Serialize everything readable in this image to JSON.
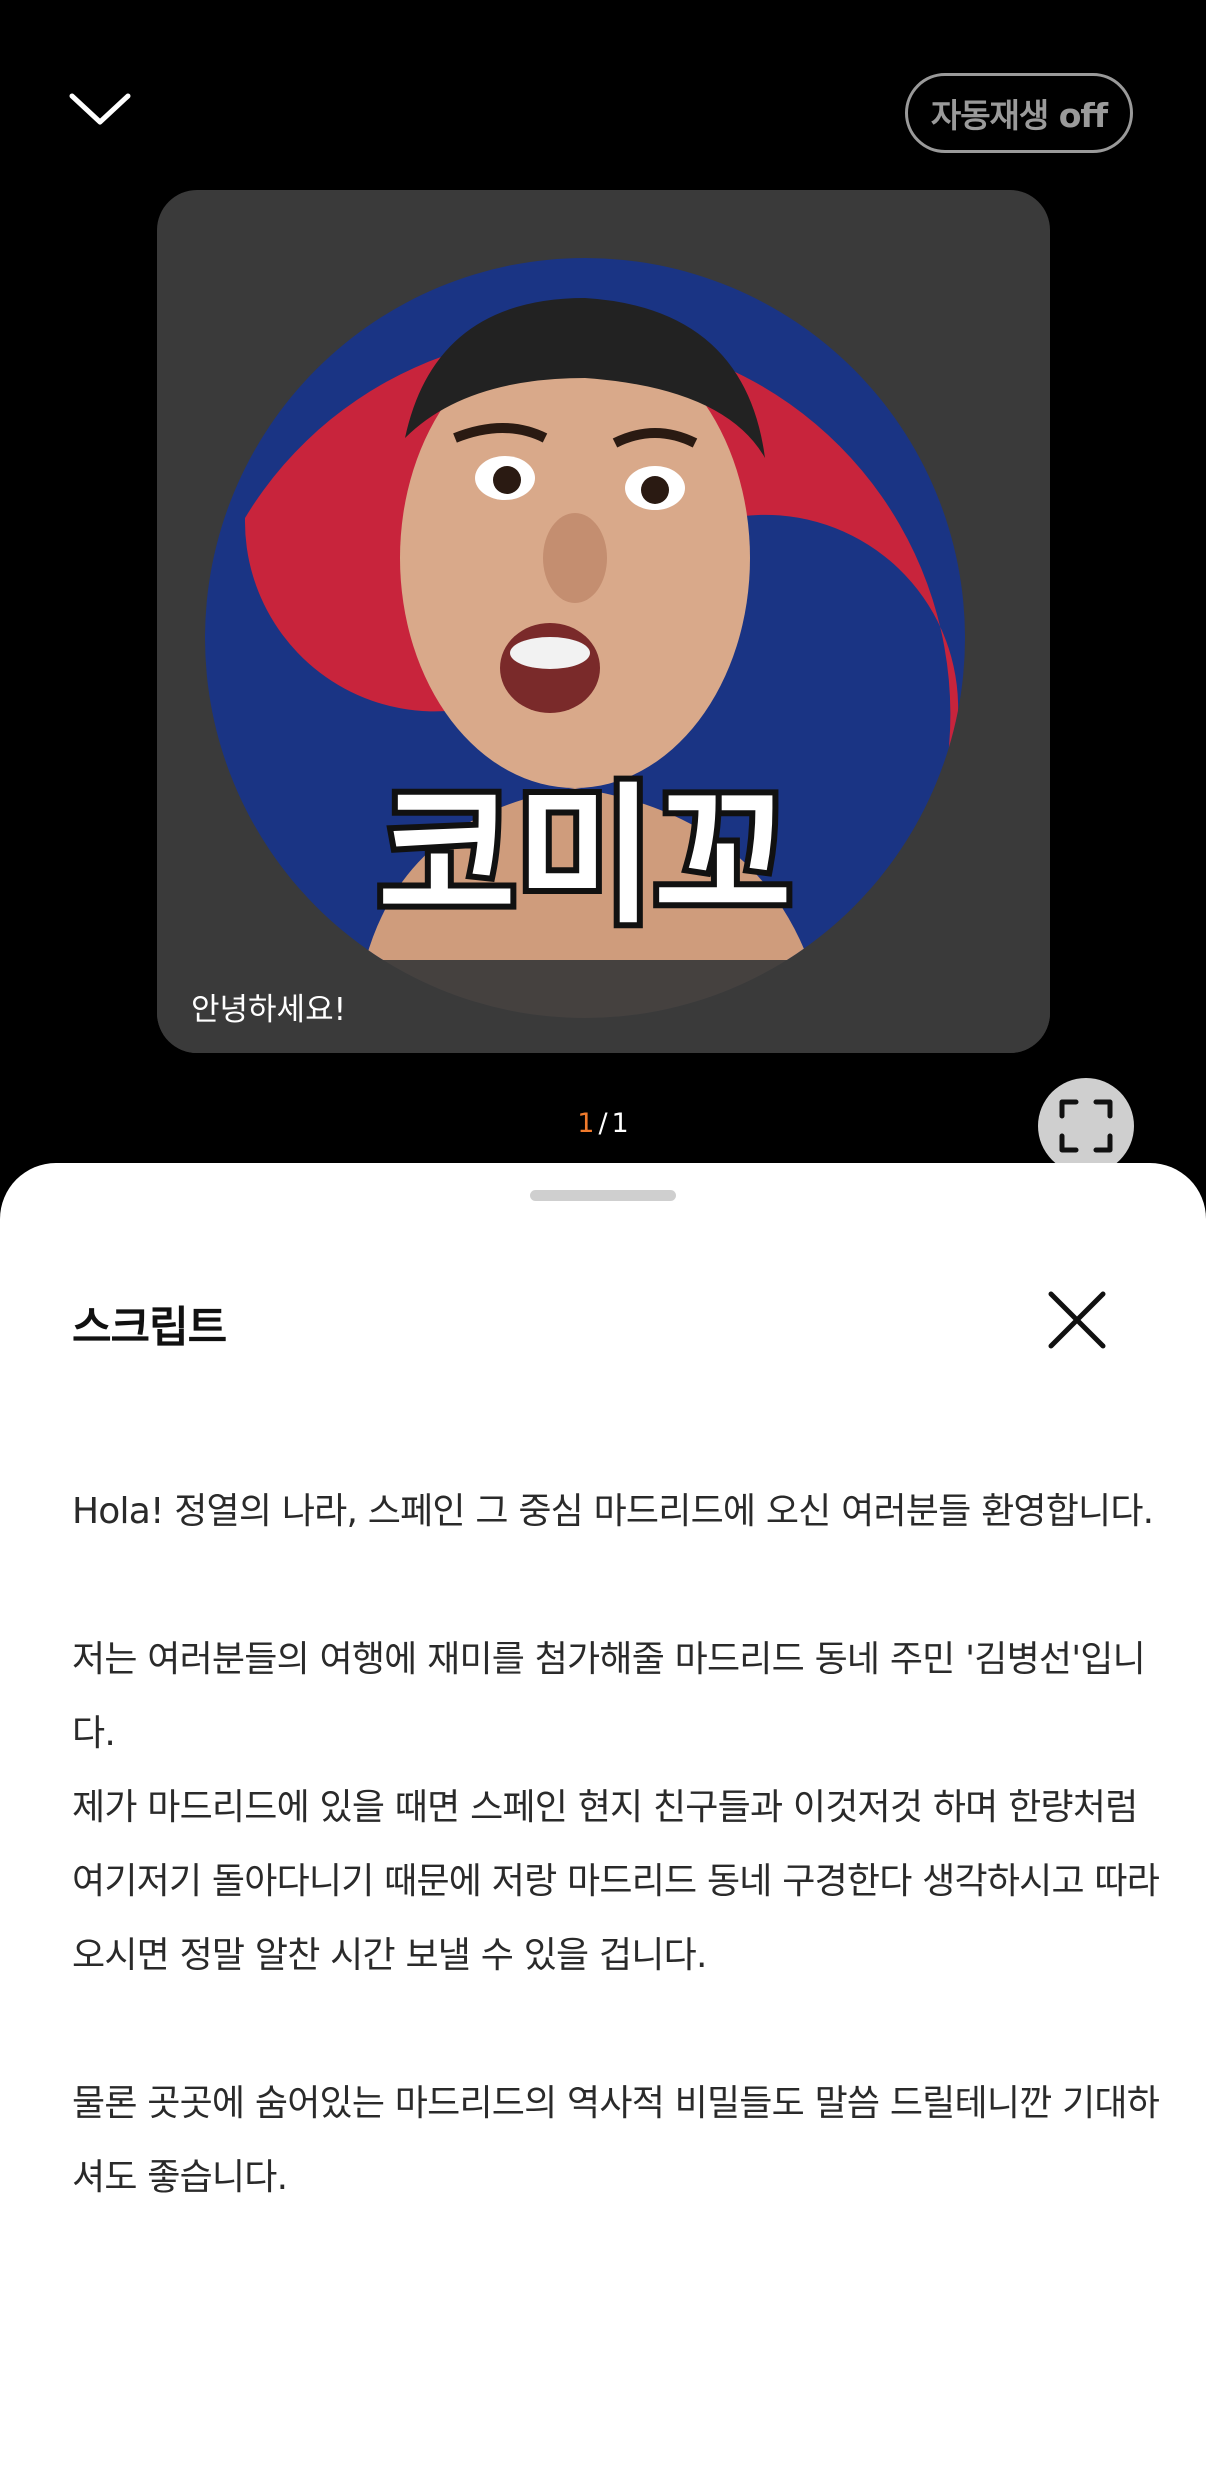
{
  "header": {
    "collapse_icon": "chevron-down-icon",
    "autoplay_label": "자동재생 off"
  },
  "media": {
    "thumbnail_text": "코미꼬",
    "caption": "안녕하세요!",
    "colors": {
      "card_bg": "#3a3a3a",
      "taegeuk_red": "#c8243c",
      "taegeuk_blue": "#1a3484"
    }
  },
  "pager": {
    "current": "1",
    "separator": "/",
    "total": "1",
    "current_color": "#f07a2c"
  },
  "fullscreen_icon": "fullscreen-icon",
  "sheet": {
    "title": "스크립트",
    "close_icon": "close-icon",
    "paragraphs": [
      "Hola! 정열의 나라, 스페인 그 중심 마드리드에 오신 여러분들 환영합니다.",
      "",
      "저는 여러분들의 여행에 재미를 첨가해줄 마드리드 동네 주민 '김병선'입니다.",
      "제가 마드리드에 있을 때면 스페인 현지 친구들과 이것저것 하며 한량처럼 여기저기 돌아다니기 때문에 저랑 마드리드 동네 구경한다 생각하시고 따라오시면 정말 알찬 시간 보낼 수 있을 겁니다.",
      "",
      "물론 곳곳에 숨어있는 마드리드의 역사적 비밀들도 말씀 드릴테니깐 기대하셔도 좋습니다."
    ]
  }
}
